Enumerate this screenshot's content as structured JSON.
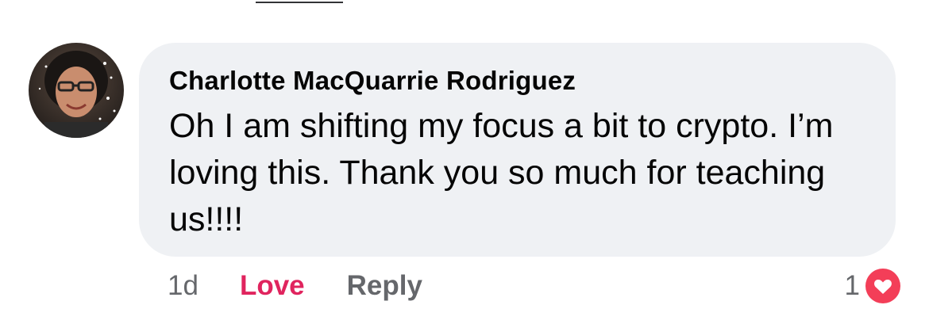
{
  "comment": {
    "author": "Charlotte MacQuarrie Rodriguez",
    "text": "Oh I am shifting my focus a bit to crypto. I’m loving this. Thank you so much for teaching us!!!!",
    "timestamp": "1d",
    "reaction_count": "1",
    "reaction_type": "heart-icon"
  },
  "actions": {
    "love_label": "Love",
    "reply_label": "Reply"
  },
  "colors": {
    "bubble_bg": "#eff1f4",
    "love_active": "#e0245e",
    "secondary_text": "#65676b",
    "reaction_heart": "#f33e58"
  }
}
